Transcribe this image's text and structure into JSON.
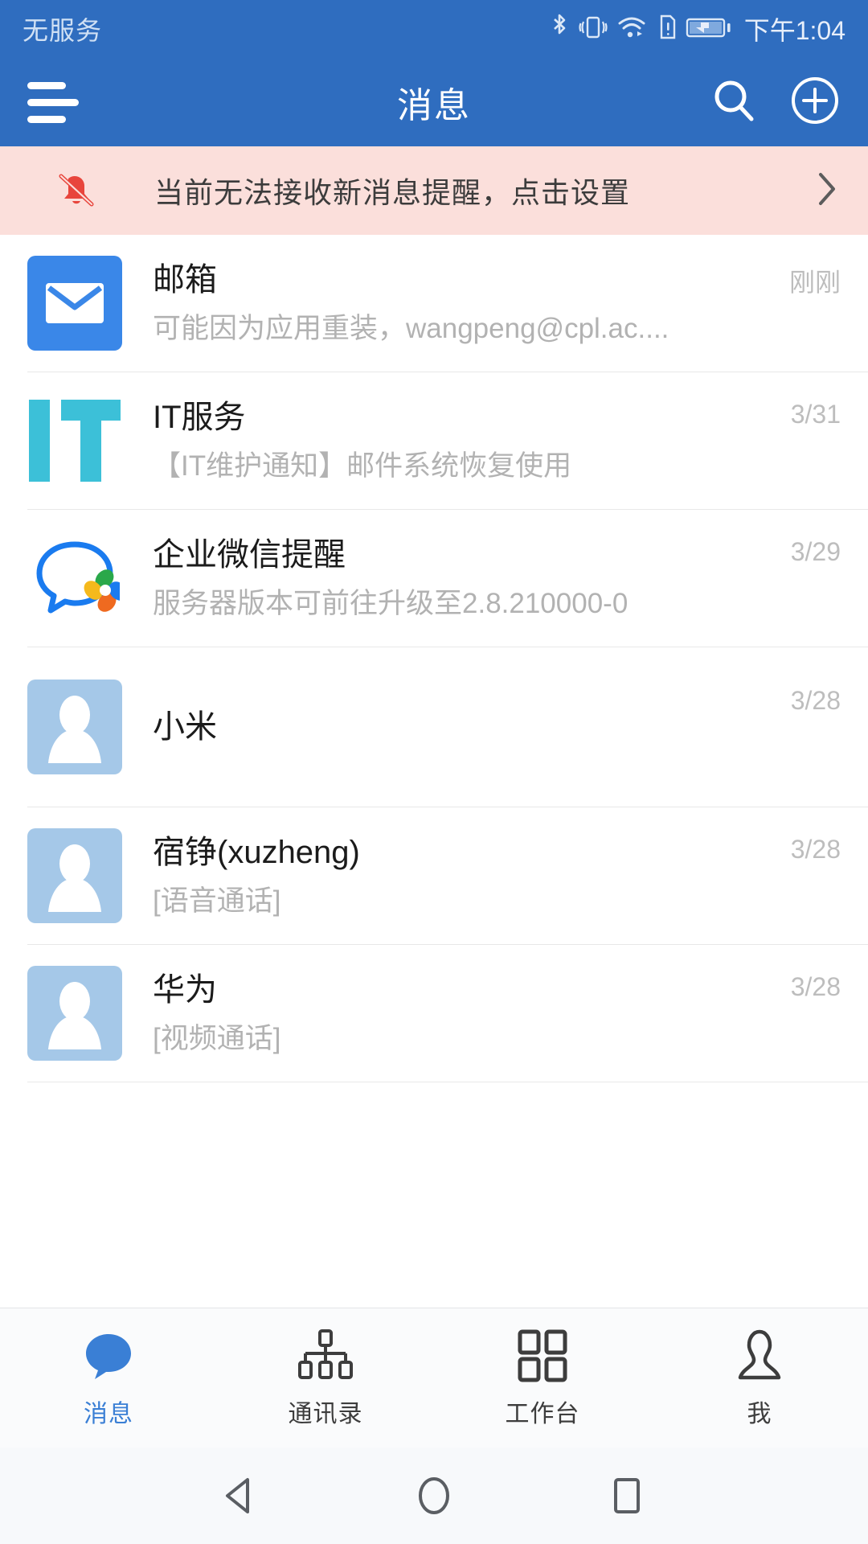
{
  "status_bar": {
    "carrier": "无服务",
    "clock": "下午1:04",
    "icons": [
      "bluetooth-icon",
      "vibrate-icon",
      "wifi-icon",
      "sim-alert-icon",
      "battery-charging-icon"
    ]
  },
  "app_bar": {
    "title": "消息",
    "menu_icon": "hamburger-menu-icon",
    "search_icon": "search-icon",
    "add_icon": "plus-circle-icon"
  },
  "banner": {
    "icon": "bell-off-icon",
    "text": "当前无法接收新消息提醒，点击设置",
    "chevron": "chevron-right-icon",
    "bg_color": "#fbdfdb",
    "icon_color": "#e8453c"
  },
  "conversations": [
    {
      "name": "邮箱",
      "preview": "可能因为应用重装，wangpeng@cpl.ac....",
      "time": "刚刚",
      "avatar_type": "mail",
      "avatar_icon": "envelope-icon",
      "avatar_color": "#3a87e8"
    },
    {
      "name": "IT服务",
      "preview": "【IT维护通知】邮件系统恢复使用",
      "time": "3/31",
      "avatar_type": "it",
      "avatar_icon": "it-logo-icon",
      "avatar_color": "#3cc0d8"
    },
    {
      "name": "企业微信提醒",
      "preview": "服务器版本可前往升级至2.8.210000-0",
      "time": "3/29",
      "avatar_type": "wecom",
      "avatar_icon": "wecom-logo-icon",
      "avatar_color": "#1a7bef"
    },
    {
      "name": "小米",
      "preview": "",
      "time": "3/28",
      "avatar_type": "person",
      "avatar_icon": "person-avatar-icon",
      "avatar_color": "#a5c8e8"
    },
    {
      "name": "宿铮(xuzheng)",
      "preview": "[语音通话]",
      "time": "3/28",
      "avatar_type": "person",
      "avatar_icon": "person-avatar-icon",
      "avatar_color": "#a5c8e8"
    },
    {
      "name": "华为",
      "preview": "[视频通话]",
      "time": "3/28",
      "avatar_type": "person",
      "avatar_icon": "person-avatar-icon",
      "avatar_color": "#a5c8e8"
    }
  ],
  "tab_bar": {
    "active_color": "#3a7fd5",
    "inactive_color": "#3d3d3d",
    "items": [
      {
        "label": "消息",
        "icon": "chat-bubble-icon",
        "active": true
      },
      {
        "label": "通讯录",
        "icon": "org-tree-icon",
        "active": false
      },
      {
        "label": "工作台",
        "icon": "grid-squares-icon",
        "active": false
      },
      {
        "label": "我",
        "icon": "person-icon",
        "active": false
      }
    ]
  },
  "android_nav": {
    "back": "back-triangle-icon",
    "home": "home-circle-icon",
    "recents": "recents-square-icon"
  },
  "theme": {
    "primary": "#2f6dbf",
    "banner_bg": "#fbdfdb",
    "divider": "#e8e8e8"
  }
}
